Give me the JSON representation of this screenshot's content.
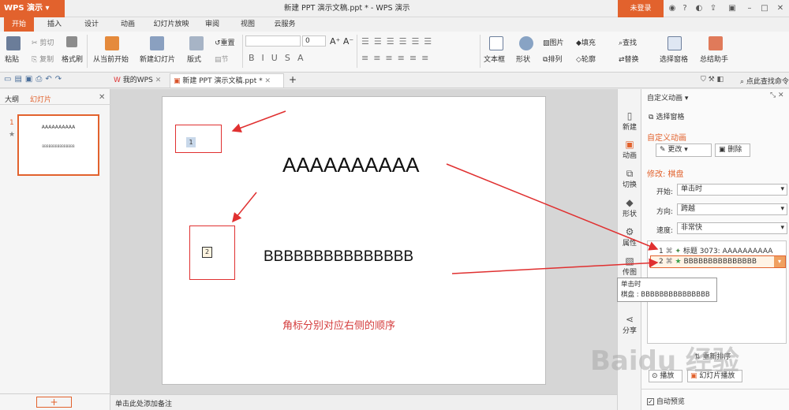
{
  "app": {
    "name": "WPS 演示",
    "doc_title": "新建 PPT 演示文稿.ppt * - WPS 演示",
    "login": "未登录"
  },
  "menu": {
    "tabs": [
      "开始",
      "插入",
      "设计",
      "动画",
      "幻灯片放映",
      "审阅",
      "视图",
      "云服务"
    ]
  },
  "ribbon": {
    "paste": "粘贴",
    "cut": "剪切",
    "copy": "复制",
    "format_painter": "格式刷",
    "from_current": "从当前开始",
    "new_slide": "新建幻灯片",
    "layout": "版式",
    "section": "节",
    "reset": "重置",
    "font_size": "0",
    "text_box": "文本框",
    "shape": "形状",
    "picture": "图片",
    "fill": "填充",
    "arrange": "排列",
    "outline": "轮廓",
    "find": "查找",
    "replace": "替换",
    "select_pane": "选择窗格",
    "summary_assistant": "总结助手",
    "format_buttons": [
      "B",
      "I",
      "U",
      "S",
      "A"
    ]
  },
  "doc_tabs": {
    "my_wps": "我的WPS",
    "current": "新建 PPT 演示文稿.ppt *"
  },
  "search": {
    "placeholder": "点此查找命令"
  },
  "left_pane": {
    "outline_tab": "大纲",
    "slides_tab": "幻灯片",
    "slide_num": "1",
    "thumb_title": "AAAAAAAAAA",
    "thumb_body": "BBBBBBBBBBBBBBB"
  },
  "slide": {
    "tag1": "1",
    "tag2": "2",
    "title": "AAAAAAAAAA",
    "body": "BBBBBBBBBBBBBBB",
    "caption": "角标分别对应右侧的顺序",
    "notes": "单击此处添加备注"
  },
  "side_bar": {
    "items": [
      "新建",
      "动画",
      "切换",
      "形状",
      "属性",
      "传图",
      "分享"
    ]
  },
  "panel": {
    "title": "自定义动画",
    "select_pane": "选择窗格",
    "section": "自定义动画",
    "change": "更改",
    "delete": "删除",
    "modify": "修改: 棋盘",
    "start_label": "开始:",
    "start_value": "单击时",
    "direction_label": "方向:",
    "direction_value": "跨越",
    "speed_label": "速度:",
    "speed_value": "非常快",
    "list": [
      {
        "num": "1",
        "text": "标题 3073: AAAAAAAAAA"
      },
      {
        "num": "2",
        "text": "BBBBBBBBBBBBBBB"
      }
    ],
    "reorder": "重新排序",
    "play": "播放",
    "slideshow": "幻灯片播放",
    "autopreview": "自动预览"
  },
  "tooltip": {
    "line1": "单击时",
    "line2": "棋盘 : BBBBBBBBBBBBBBB"
  },
  "colors": {
    "accent": "#e2622d",
    "annotation": "#e03030"
  }
}
